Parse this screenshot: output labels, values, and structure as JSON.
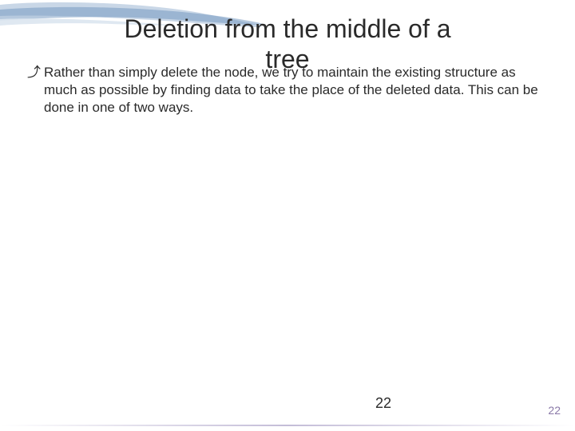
{
  "slide": {
    "title_line1": "Deletion from the middle of a",
    "title_line2": "tree",
    "bullet_glyph": "⤴",
    "bullet_text": "Rather than simply delete the node, we try to maintain the existing structure as much as possible by finding data to take the place of the deleted data. This can be done in one of two ways.",
    "page_number_center": "22",
    "page_number_corner": "22"
  }
}
